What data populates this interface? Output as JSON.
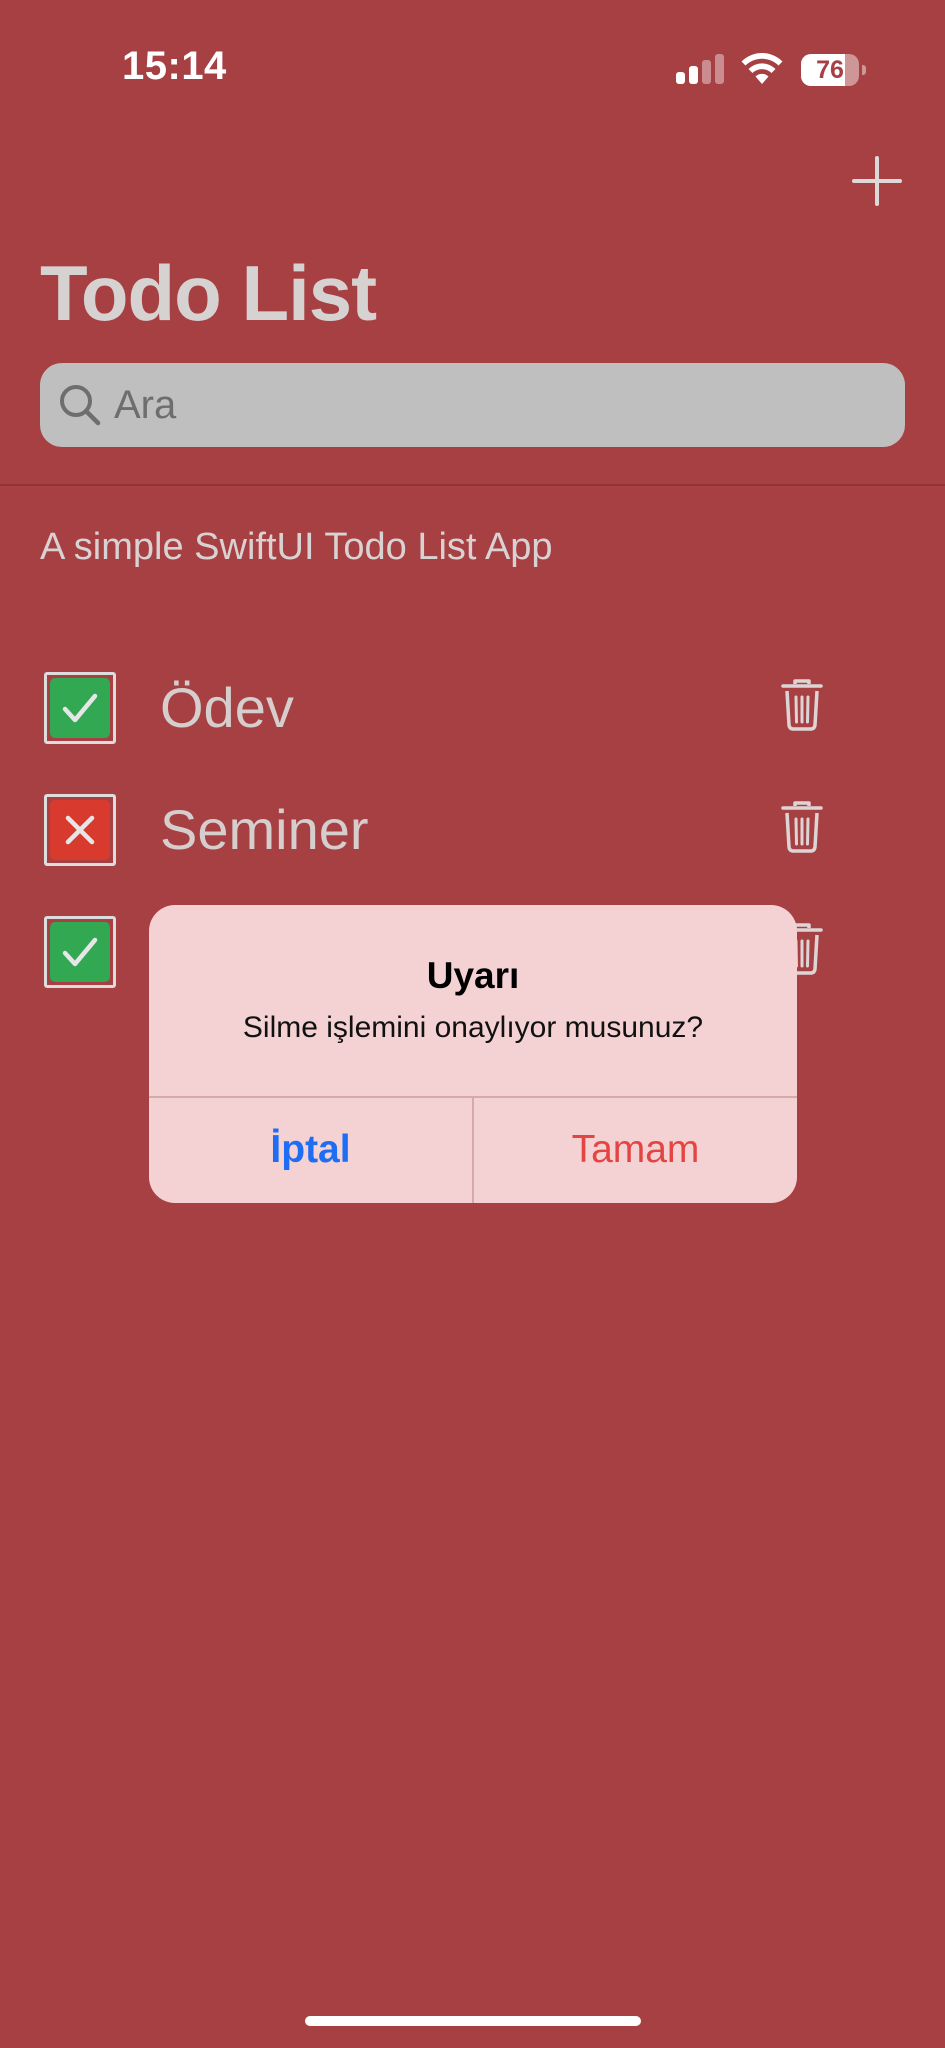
{
  "status_bar": {
    "time": "15:14",
    "battery_percent": "76",
    "battery_level": 0.76,
    "signal_bars_active": 2,
    "signal_bars_total": 4
  },
  "nav": {
    "add_icon": "plus-icon",
    "title": "Todo List"
  },
  "search": {
    "placeholder": "Ara",
    "value": "",
    "icon": "magnifier-icon"
  },
  "subtitle": "A simple SwiftUI Todo List App",
  "todos": [
    {
      "label": "Ödev",
      "done": true,
      "status_color": "#32a852"
    },
    {
      "label": "Seminer",
      "done": false,
      "status_color": "#d93a2e"
    },
    {
      "label": "",
      "done": true,
      "status_color": "#32a852"
    }
  ],
  "alert": {
    "title": "Uyarı",
    "message": "Silme işlemini onaylıyor musunuz?",
    "cancel_label": "İptal",
    "ok_label": "Tamam"
  },
  "colors": {
    "background": "#a74043",
    "alert_background": "#f4d2d3",
    "cancel_blue": "#1d6ef5",
    "ok_red": "#e34542",
    "check_green": "#32a852",
    "cross_red": "#d93a2e"
  }
}
